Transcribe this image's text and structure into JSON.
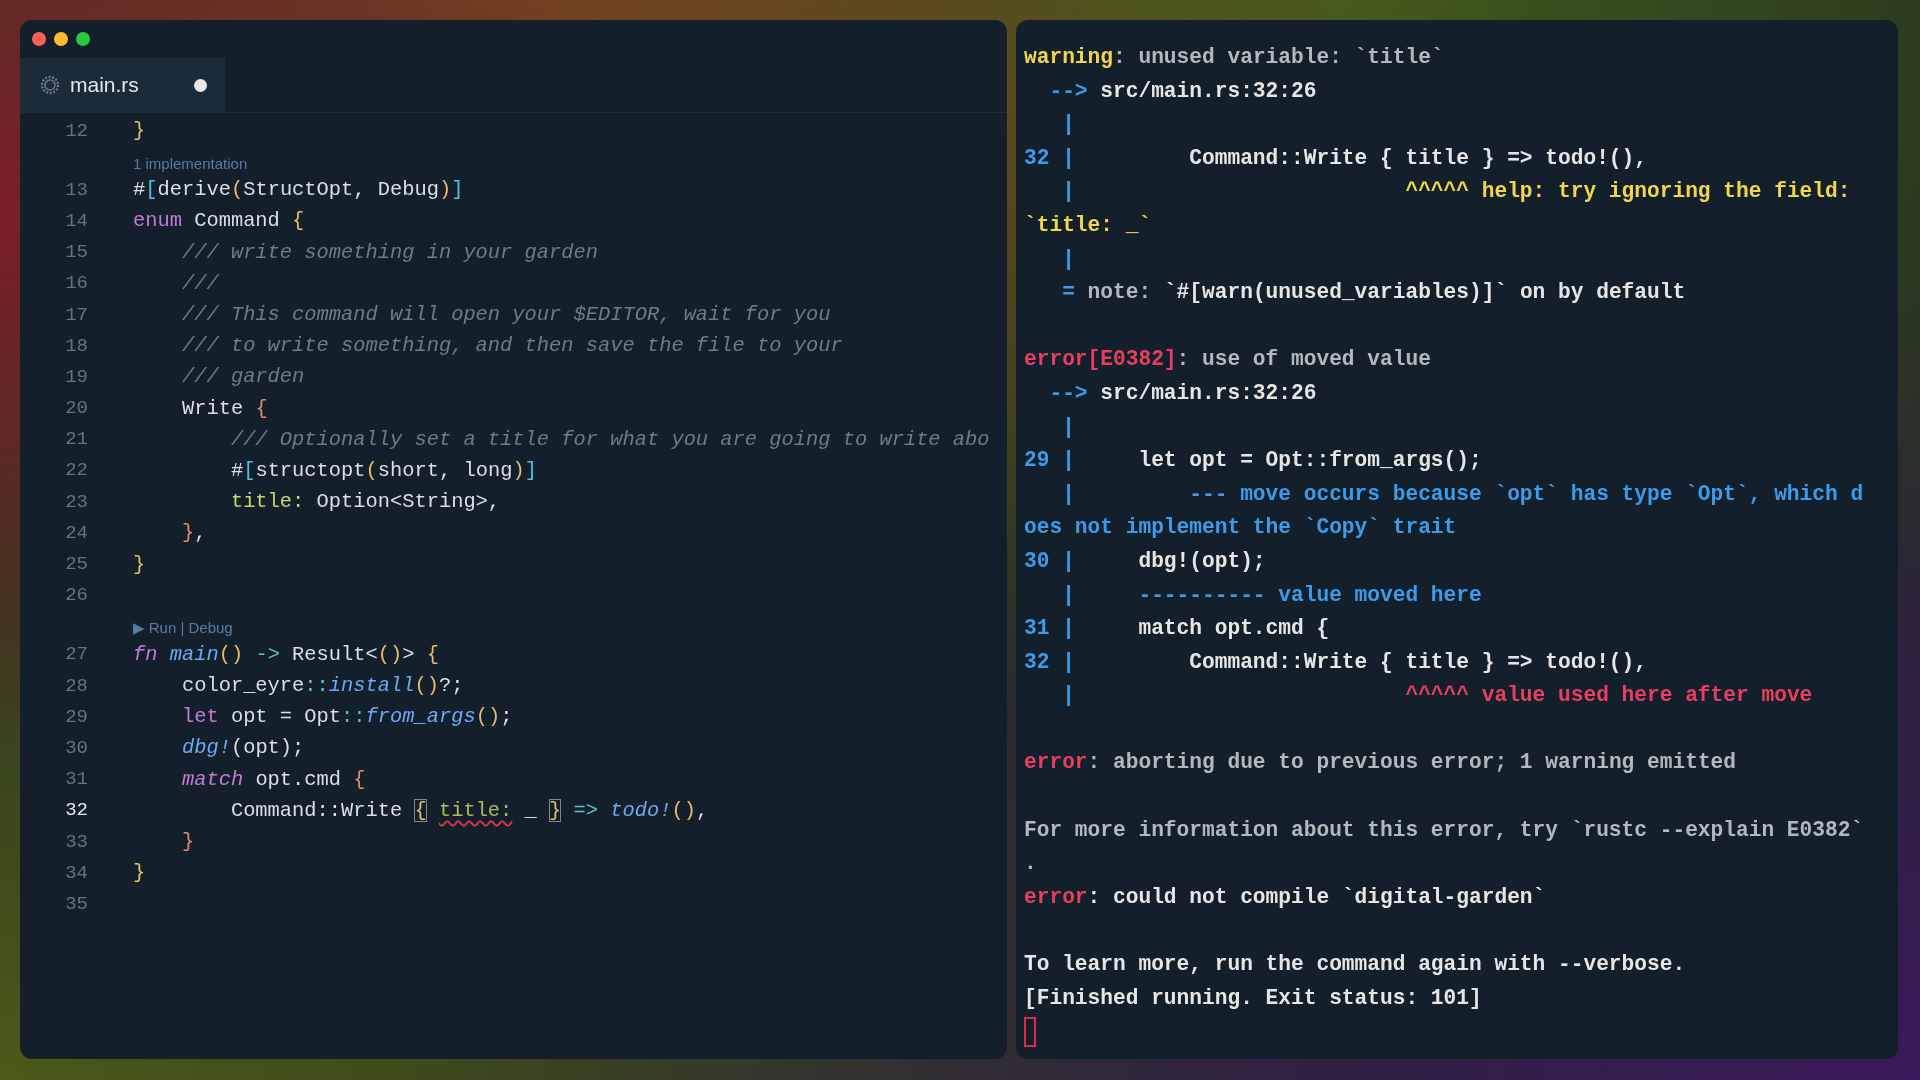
{
  "editor": {
    "tab": {
      "label": "main.rs",
      "modified": true
    },
    "lines": [
      {
        "kind": "code",
        "number": "12",
        "current": false,
        "tokens": [
          {
            "kind": "brace",
            "text": "}"
          }
        ]
      },
      {
        "kind": "lens",
        "text": "1 implementation"
      },
      {
        "kind": "code",
        "number": "13",
        "current": false,
        "tokens": [
          {
            "kind": "plain",
            "text": "#"
          },
          {
            "kind": "bracket",
            "text": "["
          },
          {
            "kind": "plain",
            "text": "derive"
          },
          {
            "kind": "brace",
            "text": "("
          },
          {
            "kind": "plain",
            "text": "StructOpt, Debug"
          },
          {
            "kind": "brace",
            "text": ")"
          },
          {
            "kind": "bracket",
            "text": "]"
          }
        ]
      },
      {
        "kind": "code",
        "number": "14",
        "current": false,
        "tokens": [
          {
            "kind": "keyword",
            "text": "enum"
          },
          {
            "kind": "plain",
            "text": " Command "
          },
          {
            "kind": "brace",
            "text": "{"
          }
        ]
      },
      {
        "kind": "code",
        "number": "15",
        "current": false,
        "tokens": [
          {
            "kind": "comment",
            "text": "    /// write something in your garden"
          }
        ]
      },
      {
        "kind": "code",
        "number": "16",
        "current": false,
        "tokens": [
          {
            "kind": "comment",
            "text": "    ///"
          }
        ]
      },
      {
        "kind": "code",
        "number": "17",
        "current": false,
        "tokens": [
          {
            "kind": "comment",
            "text": "    /// This command will open your $EDITOR, wait for you"
          }
        ]
      },
      {
        "kind": "code",
        "number": "18",
        "current": false,
        "tokens": [
          {
            "kind": "comment",
            "text": "    /// to write something, and then save the file to your"
          }
        ]
      },
      {
        "kind": "code",
        "number": "19",
        "current": false,
        "tokens": [
          {
            "kind": "comment",
            "text": "    /// garden"
          }
        ]
      },
      {
        "kind": "code",
        "number": "20",
        "current": false,
        "tokens": [
          {
            "kind": "plain",
            "text": "    Write "
          },
          {
            "kind": "brace2",
            "text": "{"
          }
        ]
      },
      {
        "kind": "code",
        "number": "21",
        "current": false,
        "tokens": [
          {
            "kind": "comment",
            "text": "        /// Optionally set a title for what you are going to write abo"
          }
        ]
      },
      {
        "kind": "code",
        "number": "22",
        "current": false,
        "tokens": [
          {
            "kind": "plain",
            "text": "        #"
          },
          {
            "kind": "bracket",
            "text": "["
          },
          {
            "kind": "plain",
            "text": "structopt"
          },
          {
            "kind": "brace",
            "text": "("
          },
          {
            "kind": "plain",
            "text": "short, long"
          },
          {
            "kind": "brace",
            "text": ")"
          },
          {
            "kind": "bracket",
            "text": "]"
          }
        ]
      },
      {
        "kind": "code",
        "number": "23",
        "current": false,
        "tokens": [
          {
            "kind": "field",
            "text": "        title:"
          },
          {
            "kind": "plain",
            "text": " Option<String>,"
          }
        ]
      },
      {
        "kind": "code",
        "number": "24",
        "current": false,
        "tokens": [
          {
            "kind": "brace2",
            "text": "    }"
          },
          {
            "kind": "plain",
            "text": ","
          }
        ]
      },
      {
        "kind": "code",
        "number": "25",
        "current": false,
        "tokens": [
          {
            "kind": "brace",
            "text": "}"
          }
        ]
      },
      {
        "kind": "code",
        "number": "26",
        "current": false
      },
      {
        "kind": "lens",
        "text": "▶ Run | Debug"
      },
      {
        "kind": "code",
        "number": "27",
        "current": false,
        "tokens": [
          {
            "kind": "keyword_italic",
            "text": "fn"
          },
          {
            "kind": "function",
            "text": " main"
          },
          {
            "kind": "brace",
            "text": "()"
          },
          {
            "kind": "operator",
            "text": " ->"
          },
          {
            "kind": "plain",
            "text": " Result<"
          },
          {
            "kind": "brace",
            "text": "()"
          },
          {
            "kind": "plain",
            "text": "> "
          },
          {
            "kind": "brace",
            "text": "{"
          }
        ]
      },
      {
        "kind": "code",
        "number": "28",
        "current": false,
        "tokens": [
          {
            "kind": "plain",
            "text": "    color_eyre"
          },
          {
            "kind": "operator",
            "text": "::"
          },
          {
            "kind": "function",
            "text": "install"
          },
          {
            "kind": "brace",
            "text": "()"
          },
          {
            "kind": "plain",
            "text": "?;"
          }
        ]
      },
      {
        "kind": "code",
        "number": "29",
        "current": false,
        "tokens": [
          {
            "kind": "keyword",
            "text": "    let"
          },
          {
            "kind": "plain",
            "text": " opt = Opt"
          },
          {
            "kind": "operator",
            "text": "::"
          },
          {
            "kind": "function",
            "text": "from_args"
          },
          {
            "kind": "brace",
            "text": "()"
          },
          {
            "kind": "plain",
            "text": ";"
          }
        ]
      },
      {
        "kind": "code",
        "number": "30",
        "current": false,
        "tokens": [
          {
            "kind": "function",
            "text": "    dbg!"
          },
          {
            "kind": "plain",
            "text": "(opt);"
          }
        ]
      },
      {
        "kind": "code",
        "number": "31",
        "current": false,
        "tokens": [
          {
            "kind": "keyword_italic",
            "text": "    match"
          },
          {
            "kind": "plain",
            "text": " opt.cmd "
          },
          {
            "kind": "brace2",
            "text": "{"
          }
        ]
      },
      {
        "kind": "code",
        "number": "32",
        "current": true,
        "tokens": [
          {
            "kind": "plain",
            "text": "        Command::Write "
          },
          {
            "kind": "matched",
            "text": "{"
          },
          {
            "kind": "field_error",
            "text": "title:"
          },
          {
            "kind": "plain",
            "text": " _ "
          },
          {
            "kind": "matched",
            "text": "}"
          },
          {
            "kind": "operator",
            "text": " =>"
          },
          {
            "kind": "function",
            "text": " todo!"
          },
          {
            "kind": "brace",
            "text": "()"
          },
          {
            "kind": "plain",
            "text": ","
          }
        ]
      },
      {
        "kind": "code",
        "number": "33",
        "current": false,
        "tokens": [
          {
            "kind": "brace2",
            "text": "    }"
          }
        ]
      },
      {
        "kind": "code",
        "number": "34",
        "current": false,
        "tokens": [
          {
            "kind": "brace",
            "text": "}"
          }
        ]
      },
      {
        "kind": "code",
        "number": "35",
        "current": false
      }
    ]
  },
  "terminal": {
    "lines": [
      {
        "kind": "text",
        "segments": [
          {
            "kind": "warning",
            "text": "warning"
          },
          {
            "kind": "dim",
            "text": ": unused variable: `title`"
          }
        ]
      },
      {
        "kind": "text",
        "segments": [
          {
            "kind": "gutter",
            "text": "  -->"
          },
          {
            "kind": "plain",
            "text": " src/main.rs:32:26"
          }
        ]
      },
      {
        "kind": "text",
        "segments": [
          {
            "kind": "gutter",
            "text": "   |"
          }
        ]
      },
      {
        "kind": "text",
        "segments": [
          {
            "kind": "gutter",
            "text": "32 |"
          },
          {
            "kind": "plain",
            "text": "         Command::Write { title } => todo!(),"
          }
        ]
      },
      {
        "kind": "text",
        "segments": [
          {
            "kind": "gutter",
            "text": "   |"
          },
          {
            "kind": "help",
            "text": "                          ^^^^^ help: try ignoring the field:"
          }
        ]
      },
      {
        "kind": "text",
        "segments": [
          {
            "kind": "help",
            "text": "`title: _`"
          }
        ]
      },
      {
        "kind": "text",
        "segments": [
          {
            "kind": "gutter",
            "text": "   |"
          }
        ]
      },
      {
        "kind": "text",
        "segments": [
          {
            "kind": "gutter",
            "text": "   ="
          },
          {
            "kind": "dim",
            "text": " note: "
          },
          {
            "kind": "plain",
            "text": "`#[warn(unused_variables)]` on by default"
          }
        ]
      },
      {
        "kind": "blank"
      },
      {
        "kind": "text",
        "segments": [
          {
            "kind": "error",
            "text": "error[E0382]"
          },
          {
            "kind": "dim",
            "text": ": use of moved value"
          }
        ]
      },
      {
        "kind": "text",
        "segments": [
          {
            "kind": "gutter",
            "text": "  -->"
          },
          {
            "kind": "plain",
            "text": " src/main.rs:32:26"
          }
        ]
      },
      {
        "kind": "text",
        "segments": [
          {
            "kind": "gutter",
            "text": "   |"
          }
        ]
      },
      {
        "kind": "text",
        "segments": [
          {
            "kind": "gutter",
            "text": "29 |"
          },
          {
            "kind": "plain",
            "text": "     let opt = Opt::from_args();"
          }
        ]
      },
      {
        "kind": "text",
        "segments": [
          {
            "kind": "gutter",
            "text": "   |         --- move occurs because `opt` has type `Opt`, which d"
          }
        ]
      },
      {
        "kind": "text",
        "segments": [
          {
            "kind": "gutter",
            "text": "oes not implement the `Copy` trait"
          }
        ]
      },
      {
        "kind": "text",
        "segments": [
          {
            "kind": "gutter",
            "text": "30 |"
          },
          {
            "kind": "plain",
            "text": "     dbg!(opt);"
          }
        ]
      },
      {
        "kind": "text",
        "segments": [
          {
            "kind": "gutter",
            "text": "   |     ---------- value moved here"
          }
        ]
      },
      {
        "kind": "text",
        "segments": [
          {
            "kind": "gutter",
            "text": "31 |"
          },
          {
            "kind": "plain",
            "text": "     match opt.cmd {"
          }
        ]
      },
      {
        "kind": "text",
        "segments": [
          {
            "kind": "gutter",
            "text": "32 |"
          },
          {
            "kind": "plain",
            "text": "         Command::Write { title } => todo!(),"
          }
        ]
      },
      {
        "kind": "text",
        "segments": [
          {
            "kind": "gutter",
            "text": "   |"
          },
          {
            "kind": "error",
            "text": "                          ^^^^^ value used here after move"
          }
        ]
      },
      {
        "kind": "blank"
      },
      {
        "kind": "text",
        "segments": [
          {
            "kind": "error",
            "text": "error"
          },
          {
            "kind": "dim",
            "text": ": aborting due to previous error; 1 warning emitted"
          }
        ]
      },
      {
        "kind": "blank"
      },
      {
        "kind": "text",
        "segments": [
          {
            "kind": "dim",
            "text": "For more information about this error, try `rustc --explain E0382`"
          }
        ]
      },
      {
        "kind": "text",
        "segments": [
          {
            "kind": "dim",
            "text": "."
          }
        ]
      },
      {
        "kind": "text",
        "segments": [
          {
            "kind": "error",
            "text": "error"
          },
          {
            "kind": "plain",
            "text": ": could not compile `digital-garden`"
          }
        ]
      },
      {
        "kind": "blank"
      },
      {
        "kind": "text",
        "segments": [
          {
            "kind": "plain",
            "text": "To learn more, run the command again with --verbose."
          }
        ]
      },
      {
        "kind": "text",
        "segments": [
          {
            "kind": "plain",
            "text": "[Finished running. Exit status: 101]"
          }
        ]
      }
    ]
  }
}
